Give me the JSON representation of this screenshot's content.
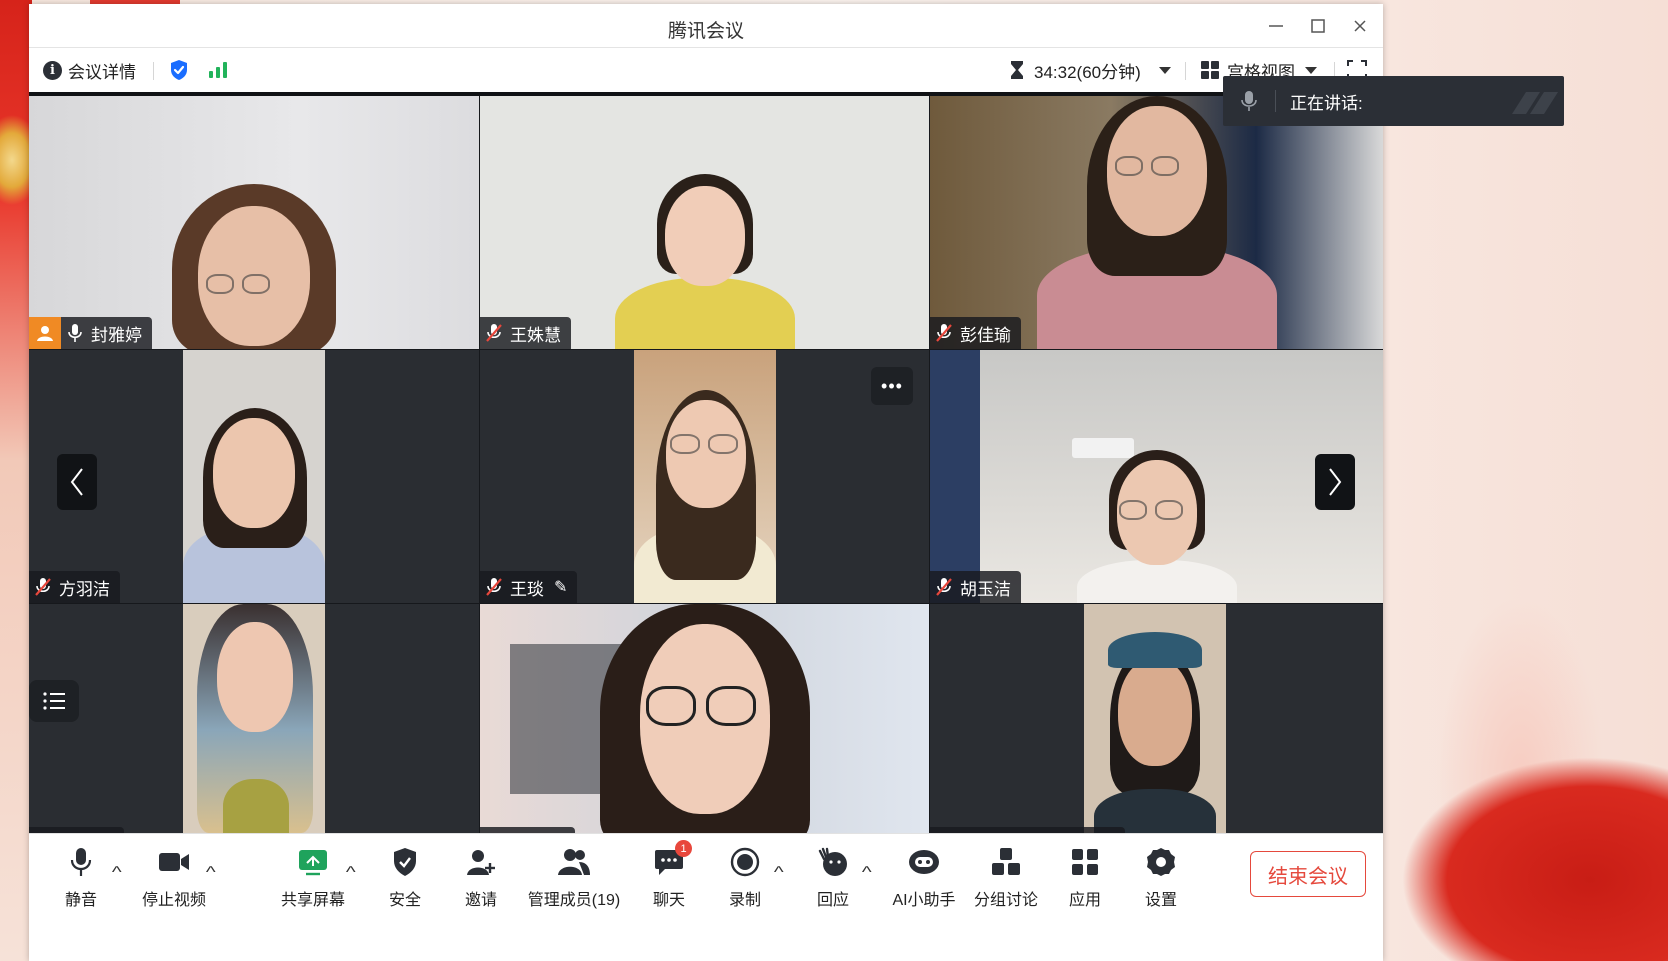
{
  "window": {
    "title": "腾讯会议"
  },
  "infobar": {
    "details_label": "会议详情",
    "timer": "34:32(60分钟)",
    "view_label": "宫格视图"
  },
  "speaking": {
    "label": "正在讲话:"
  },
  "participants": [
    {
      "name": "封雅婷",
      "host": true,
      "muted": false
    },
    {
      "name": "王姝慧",
      "muted": true
    },
    {
      "name": "彭佳瑜",
      "muted": true
    },
    {
      "name": "方羽洁",
      "muted": true
    },
    {
      "name": "王琰",
      "muted": true,
      "editing": true
    },
    {
      "name": "胡玉洁",
      "muted": true
    },
    {
      "name": "",
      "muted": true
    },
    {
      "name": "",
      "muted": true
    },
    {
      "name": "",
      "muted": true
    }
  ],
  "toolbar": {
    "mute": "静音",
    "stop_video": "停止视频",
    "share_screen": "共享屏幕",
    "security": "安全",
    "invite": "邀请",
    "manage_members": "管理成员(19)",
    "chat": "聊天",
    "chat_badge": "1",
    "record": "录制",
    "react": "回应",
    "ai_assistant": "AI小助手",
    "breakout": "分组讨论",
    "apps": "应用",
    "settings": "设置",
    "end_meeting": "结束会议"
  },
  "colors": {
    "accent_blue": "#1a6dff",
    "signal_green": "#22b35b",
    "host_orange": "#f08a24",
    "muted_red": "#e8473c",
    "end_red": "#e5493d",
    "share_green": "#1fa35c"
  }
}
